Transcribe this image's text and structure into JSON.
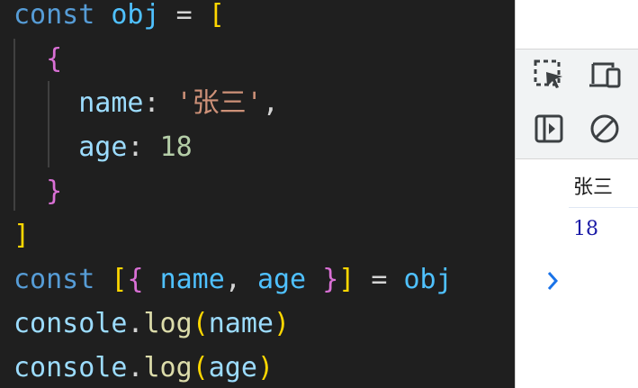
{
  "editor": {
    "lines": [
      [
        [
          "const ",
          "kw"
        ],
        [
          "obj",
          "var"
        ],
        [
          " = ",
          "pun"
        ],
        [
          "[",
          "b1"
        ]
      ],
      [
        [
          "  ",
          "pun"
        ],
        [
          "{",
          "b2"
        ]
      ],
      [
        [
          "    ",
          "pun"
        ],
        [
          "name",
          "prop"
        ],
        [
          ": ",
          "pun"
        ],
        [
          "'张三'",
          "str"
        ],
        [
          ",",
          "pun"
        ]
      ],
      [
        [
          "    ",
          "pun"
        ],
        [
          "age",
          "prop"
        ],
        [
          ": ",
          "pun"
        ],
        [
          "18",
          "num"
        ]
      ],
      [
        [
          "  ",
          "pun"
        ],
        [
          "}",
          "b2"
        ]
      ],
      [
        [
          "]",
          "b1"
        ]
      ],
      [
        [
          "const ",
          "kw"
        ],
        [
          "[",
          "b1"
        ],
        [
          "{",
          "b2"
        ],
        [
          " ",
          "pun"
        ],
        [
          "name",
          "var"
        ],
        [
          ", ",
          "pun"
        ],
        [
          "age",
          "var"
        ],
        [
          " ",
          "pun"
        ],
        [
          "}",
          "b2"
        ],
        [
          "]",
          "b1"
        ],
        [
          " = ",
          "pun"
        ],
        [
          "obj",
          "var"
        ]
      ],
      [
        [
          "console",
          "prop"
        ],
        [
          ".",
          "pun"
        ],
        [
          "log",
          "fn"
        ],
        [
          "(",
          "b1"
        ],
        [
          "name",
          "prop"
        ],
        [
          ")",
          "b1"
        ]
      ],
      [
        [
          "console",
          "prop"
        ],
        [
          ".",
          "pun"
        ],
        [
          "log",
          "fn"
        ],
        [
          "(",
          "b1"
        ],
        [
          "age",
          "prop"
        ],
        [
          ")",
          "b1"
        ]
      ]
    ]
  },
  "devtools": {
    "toolbar": [
      {
        "icon": "inspect-element-icon",
        "label": "Select an element"
      },
      {
        "icon": "device-toolbar-icon",
        "label": "Toggle device toolbar"
      },
      {
        "icon": "sidebar-toggle-icon",
        "label": "Show console sidebar"
      },
      {
        "icon": "clear-console-icon",
        "label": "Clear console"
      }
    ],
    "console": {
      "outputs": [
        "张三",
        "18"
      ],
      "prompt_icon": "chevron-right-icon"
    }
  },
  "colors": {
    "keyword": "#569cd6",
    "variable": "#4fc1ff",
    "property": "#9cdcfe",
    "function": "#dcdcaa",
    "string": "#ce9178",
    "number": "#b5cea8",
    "bracket_1": "#ffd700",
    "bracket_2": "#da70d6",
    "console_string": "#1a1a1a",
    "console_number": "#1a1aa6",
    "prompt": "#1a73e8"
  }
}
